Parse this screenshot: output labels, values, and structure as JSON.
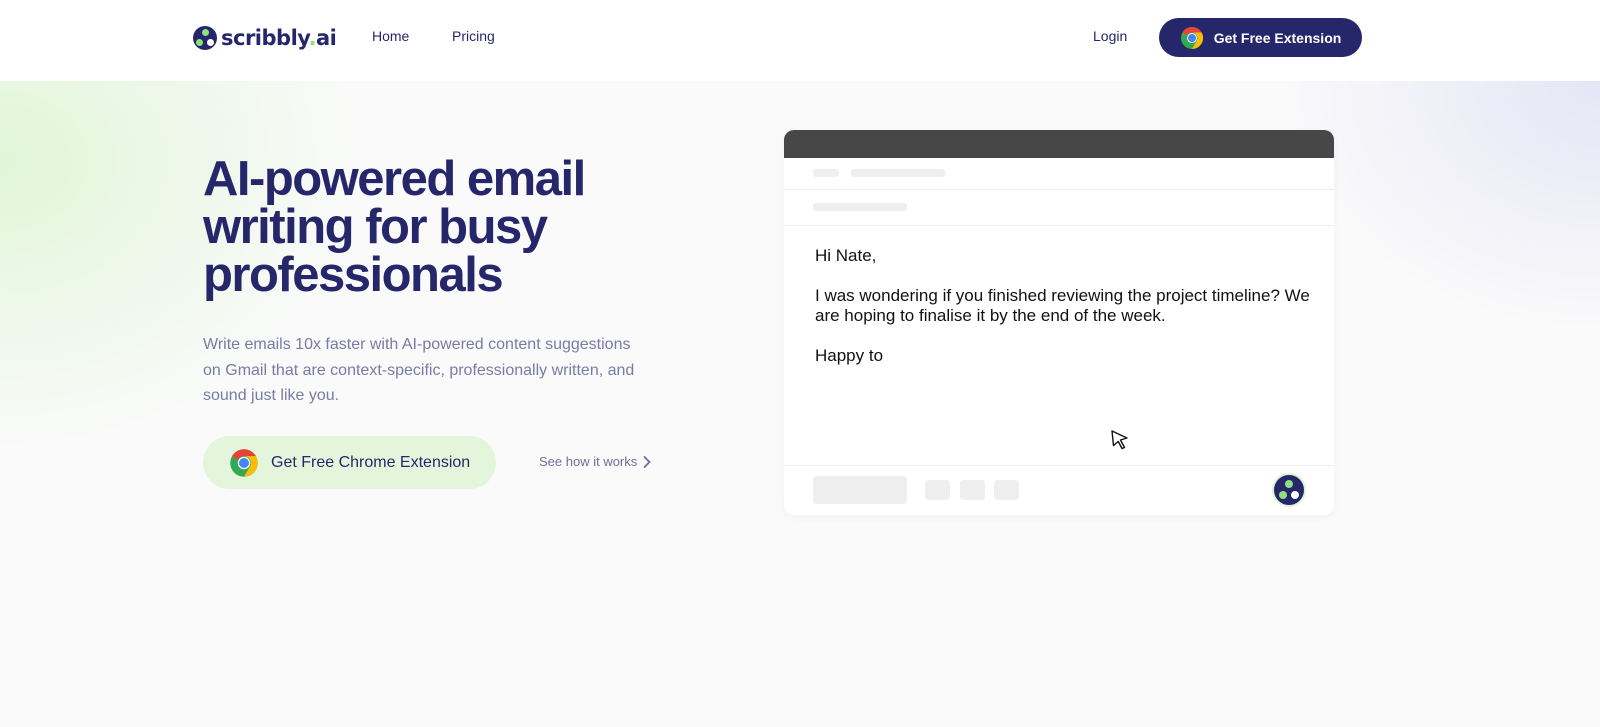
{
  "brand": {
    "name_main": "scribbly",
    "name_dot": ".",
    "name_tld": "ai",
    "accent_color": "#26276b",
    "highlight_color": "#8ee07a"
  },
  "nav": {
    "home": "Home",
    "pricing": "Pricing",
    "login": "Login",
    "cta": "Get Free Extension"
  },
  "hero": {
    "title": "AI-powered email writing for busy professionals",
    "subtitle": "Write emails 10x faster with AI-powered content suggestions on Gmail that are context-specific, professionally written, and sound just like you.",
    "cta": "Get Free Chrome Extension",
    "secondary": "See how it works"
  },
  "email_mock": {
    "greeting": "Hi Nate,",
    "body": "I was wondering if you finished reviewing the project timeline? We are hoping to finalise it by the end of the week.",
    "partial": "Happy to"
  },
  "icons": {
    "logo": "scribbly-logo-icon",
    "browser": "chrome-icon",
    "chevron": "chevron-right-icon",
    "cursor": "mouse-pointer-icon",
    "assistant": "scribbly-assistant-icon"
  }
}
